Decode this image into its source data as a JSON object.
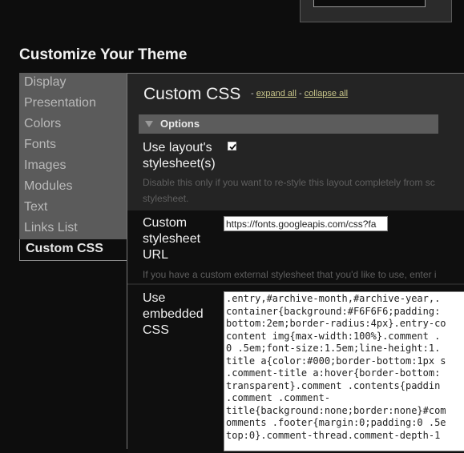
{
  "page_title": "Customize Your Theme",
  "sidebar": {
    "items": [
      {
        "label": "Display"
      },
      {
        "label": "Presentation"
      },
      {
        "label": "Colors"
      },
      {
        "label": "Fonts"
      },
      {
        "label": "Images"
      },
      {
        "label": "Modules"
      },
      {
        "label": "Text"
      },
      {
        "label": "Links List"
      },
      {
        "label": "Custom CSS"
      }
    ]
  },
  "panel": {
    "title": "Custom CSS",
    "separator": "-",
    "expand_all": "expand all",
    "collapse_all": "collapse all",
    "options_label": "Options",
    "layout_stylesheet": {
      "label_line1": "Use layout's",
      "label_line2": "stylesheet(s)",
      "checked": true,
      "help_line1": "Disable this only if you want to re-style this layout completely from sc",
      "help_line2": "stylesheet."
    },
    "custom_stylesheet": {
      "label_line1": "Custom",
      "label_line2": "stylesheet",
      "label_line3": "URL",
      "value": "https://fonts.googleapis.com/css?fa",
      "help": "If you have a custom external stylesheet that you'd like to use, enter i"
    },
    "embedded_css": {
      "label_line1": "Use",
      "label_line2": "embedded",
      "label_line3": "CSS",
      "value": ".entry,#archive-month,#archive-year,.\ncontainer{background:#F6F6F6;padding:\nbottom:2em;border-radius:4px}.entry-co\ncontent img{max-width:100%}.comment .\n0 .5em;font-size:1.5em;line-height:1.\ntitle a{color:#000;border-bottom:1px s\n.comment-title a:hover{border-bottom:\ntransparent}.comment .contents{paddin\n.comment .comment-\ntitle{background:none;border:none}#com\nomments .footer{margin:0;padding:0 .5e\ntop:0}.comment-thread.comment-depth-1"
    }
  }
}
